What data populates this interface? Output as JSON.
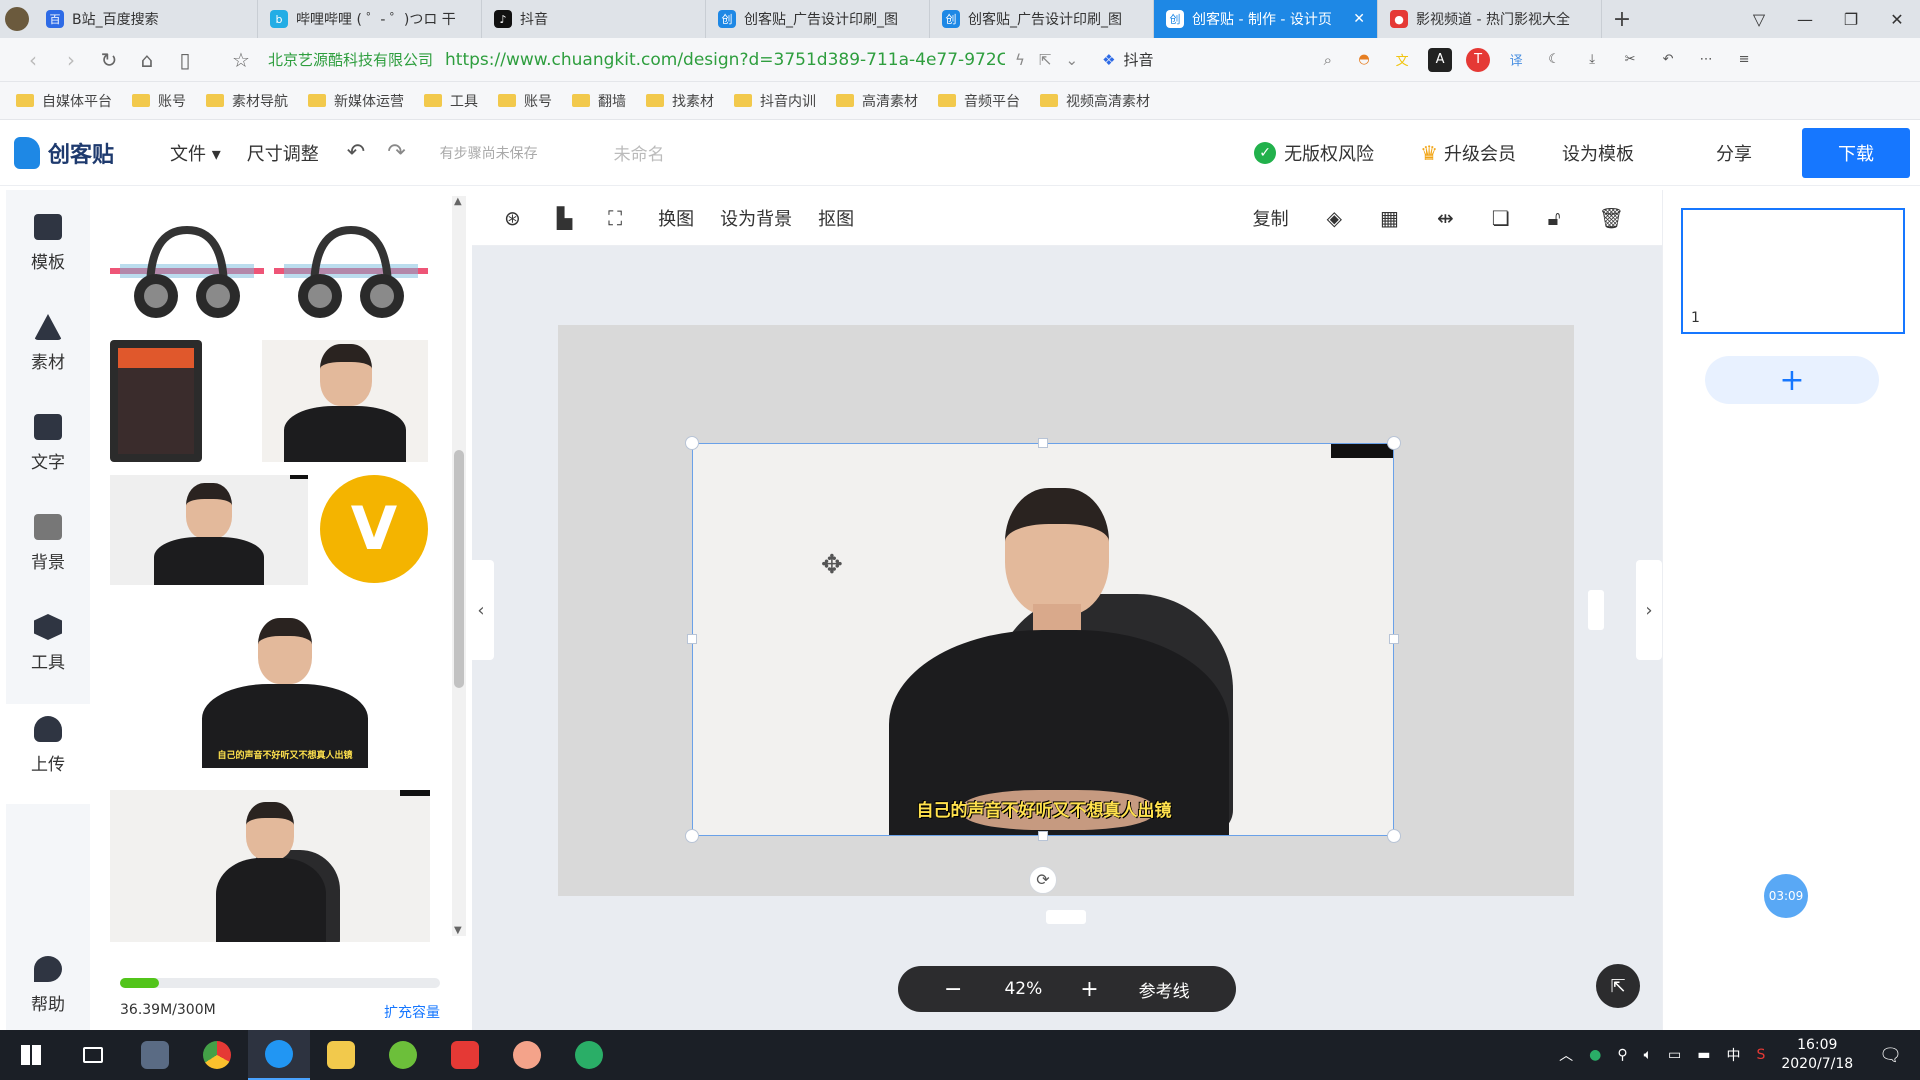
{
  "browser": {
    "tabs": [
      {
        "title": "B站_百度搜索",
        "color": "#2e6be6",
        "active": false
      },
      {
        "title": "哔哩哔哩 ( ゜- ゜)つロ 干",
        "color": "#23ade5",
        "active": false
      },
      {
        "title": "抖音",
        "color": "#111111",
        "active": false
      },
      {
        "title": "创客贴_广告设计印刷_图",
        "color": "#1e88e5",
        "active": false
      },
      {
        "title": "创客贴_广告设计印刷_图",
        "color": "#1e88e5",
        "active": false
      },
      {
        "title": "创客贴 - 制作 - 设计页",
        "color": "#1e88e5",
        "active": true
      },
      {
        "title": "影视频道 - 热门影视大全",
        "color": "#e53935",
        "active": false
      }
    ],
    "site_name": "北京艺源酷科技有限公司",
    "url": "https://www.chuangkit.com/design?d=3751d389-711a-4e77-972C",
    "search_engine_label": "抖音",
    "bookmarks": [
      "自媒体平台",
      "账号",
      "素材导航",
      "新媒体运营",
      "工具",
      "账号",
      "翻墙",
      "找素材",
      "抖音内训",
      "高清素材",
      "音频平台",
      "视频高清素材"
    ]
  },
  "app": {
    "brand": "创客贴",
    "menu_file": "文件",
    "menu_resize": "尺寸调整",
    "unsaved_hint": "有步骤尚未保存",
    "doc_name": "未命名",
    "no_copyright_risk": "无版权风险",
    "upgrade": "升级会员",
    "set_template": "设为模板",
    "share": "分享",
    "download": "下载"
  },
  "rail": [
    {
      "label": "模板",
      "icon": "template-icon"
    },
    {
      "label": "素材",
      "icon": "material-icon"
    },
    {
      "label": "文字",
      "icon": "text-icon"
    },
    {
      "label": "背景",
      "icon": "background-icon"
    },
    {
      "label": "工具",
      "icon": "tools-icon"
    },
    {
      "label": "上传",
      "icon": "upload-icon"
    },
    {
      "label": "帮助",
      "icon": "help-icon"
    }
  ],
  "panel": {
    "thumb_caption": "自己的声音不好听又不想真人出镜",
    "storage_used": "36.39M/300M",
    "storage_fraction": 0.121,
    "expand": "扩充容量",
    "badge_letter": "V"
  },
  "toolbar": {
    "replace": "换图",
    "set_bg": "设为背景",
    "cutout": "抠图",
    "copy": "复制"
  },
  "canvas": {
    "caption": "自己的声音不好听又不想真人出镜",
    "zoom": "42%",
    "guides": "参考线"
  },
  "pages": {
    "page_number": "1",
    "add": "+"
  },
  "timer": "03:09",
  "taskbar": {
    "time": "16:09",
    "date": "2020/7/18",
    "ime": "中"
  }
}
